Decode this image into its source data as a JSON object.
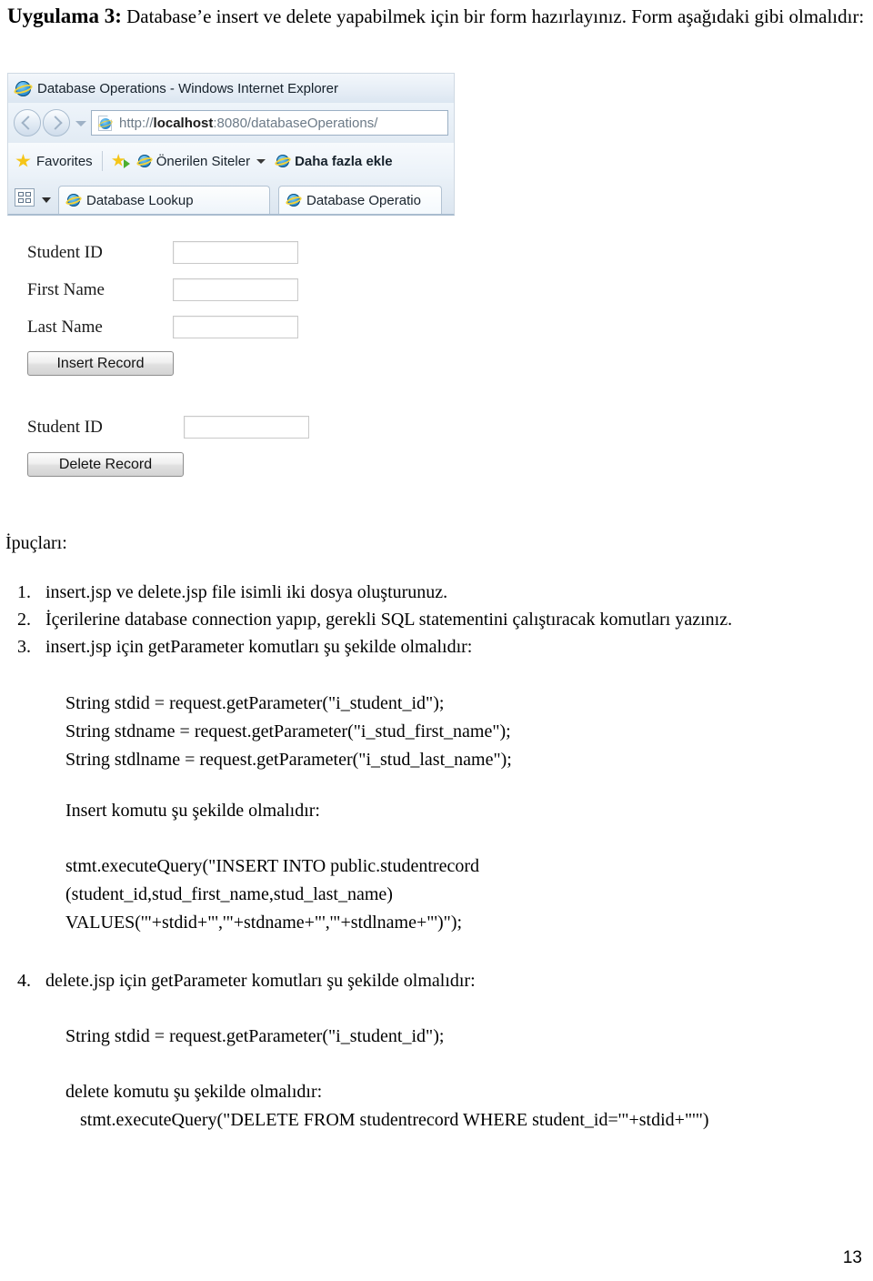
{
  "heading": {
    "lead": "Uygulama 3:",
    "rest": " Database’e insert ve delete yapabilmek için bir form hazırlayınız. Form aşağıdaki gibi olmalıdır:"
  },
  "browser": {
    "window_title": "Database Operations - Windows Internet Explorer",
    "url": {
      "scheme": "http://",
      "host": "localhost",
      "path": ":8080/databaseOperations/"
    },
    "favorites": {
      "favorites_label": "Favorites",
      "suggested_sites_label": "Önerilen Siteler",
      "add_more_label": "Daha fazla ekle"
    },
    "tabs": [
      {
        "label": "Database Lookup",
        "active": false
      },
      {
        "label": "Database Operatio",
        "active": true
      }
    ],
    "form": {
      "insert": {
        "fields": [
          {
            "label": "Student ID",
            "value": ""
          },
          {
            "label": "First Name",
            "value": ""
          },
          {
            "label": "Last Name",
            "value": ""
          }
        ],
        "button_label": "Insert Record"
      },
      "delete": {
        "fields": [
          {
            "label": "Student ID",
            "value": ""
          }
        ],
        "button_label": "Delete Record"
      }
    }
  },
  "hints": {
    "title": "İpuçları:",
    "items": [
      {
        "num": "1.",
        "text": "insert.jsp ve delete.jsp file isimli iki dosya oluşturunuz."
      },
      {
        "num": "2.",
        "text": "İçerilerine database connection yapıp, gerekli SQL statementini çalıştıracak komutları yazınız."
      },
      {
        "num": "3.",
        "text": "insert.jsp için getParameter komutları şu şekilde olmalıdır:"
      },
      {
        "num": "4.",
        "text": "delete.jsp için getParameter komutları şu şekilde olmalıdır:"
      }
    ]
  },
  "code": {
    "insert_getparams": "String stdid = request.getParameter(\"i_student_id\");\nString stdname = request.getParameter(\"i_stud_first_name\");\nString stdlname = request.getParameter(\"i_stud_last_name\");",
    "insert_caption": "Insert komutu şu şekilde olmalıdır:",
    "insert_statement": "stmt.executeQuery(\"INSERT INTO public.studentrecord\n(student_id,stud_first_name,stud_last_name)\nVALUES('\"+stdid+\"','\"+stdname+\"','\"+stdlname+\"')\");",
    "delete_getparams": "String stdid = request.getParameter(\"i_student_id\");",
    "delete_caption": "delete komutu şu şekilde olmalıdır:",
    "delete_statement": "stmt.executeQuery(\"DELETE FROM studentrecord WHERE student_id='\"+stdid+\"'\")"
  },
  "footer": {
    "page_number": "13"
  }
}
